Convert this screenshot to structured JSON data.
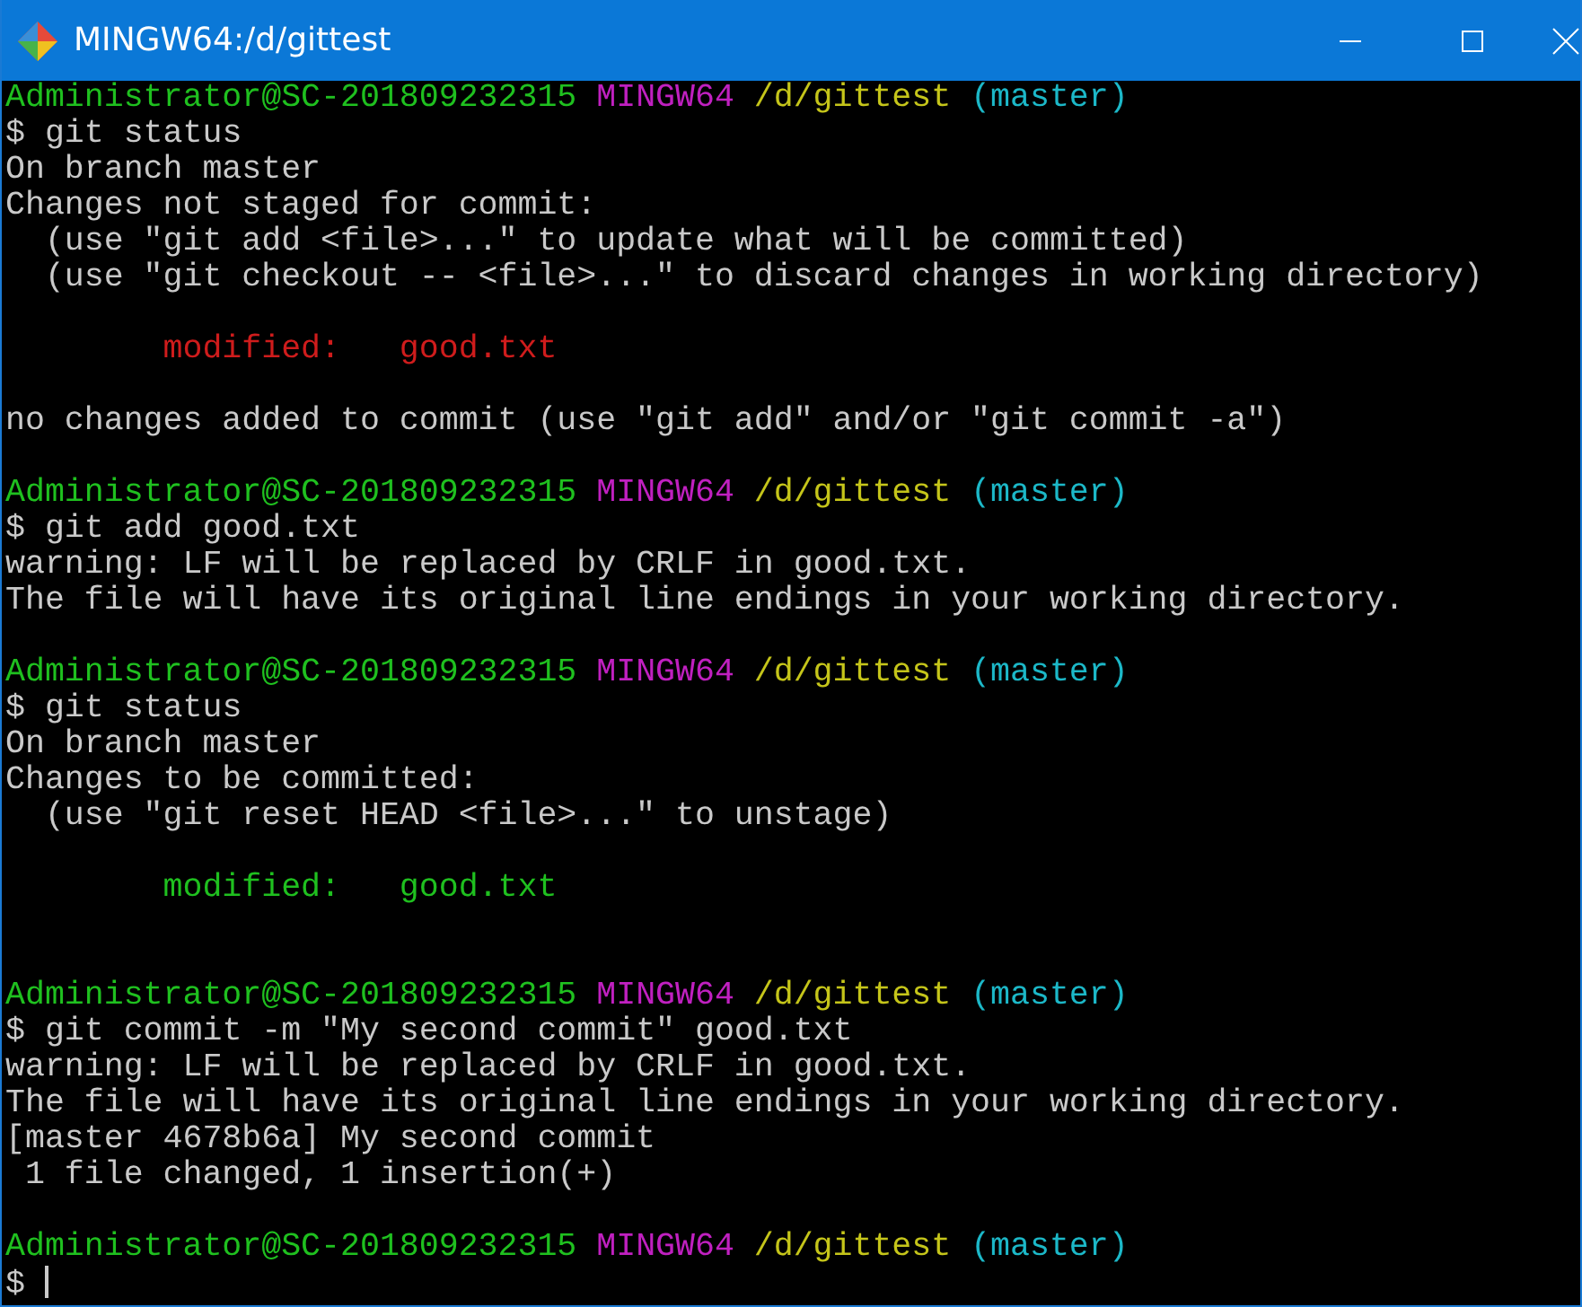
{
  "window": {
    "title": "MINGW64:/d/gittest"
  },
  "terminal_lines": [
    {
      "kind": "prompt",
      "user": "Administrator@SC-201809232315",
      "host": "MINGW64",
      "path": "/d/gittest",
      "branch": "(master)"
    },
    {
      "kind": "command",
      "symbol": "$",
      "text": "git status"
    },
    {
      "kind": "output",
      "text": "On branch master"
    },
    {
      "kind": "output",
      "text": "Changes not staged for commit:"
    },
    {
      "kind": "output",
      "text": "  (use \"git add <file>...\" to update what will be committed)"
    },
    {
      "kind": "output",
      "text": "  (use \"git checkout -- <file>...\" to discard changes in working directory)"
    },
    {
      "kind": "blank"
    },
    {
      "kind": "unstaged",
      "text": "        modified:   good.txt"
    },
    {
      "kind": "blank"
    },
    {
      "kind": "output",
      "text": "no changes added to commit (use \"git add\" and/or \"git commit -a\")"
    },
    {
      "kind": "blank"
    },
    {
      "kind": "prompt",
      "user": "Administrator@SC-201809232315",
      "host": "MINGW64",
      "path": "/d/gittest",
      "branch": "(master)"
    },
    {
      "kind": "command",
      "symbol": "$",
      "text": "git add good.txt"
    },
    {
      "kind": "output",
      "text": "warning: LF will be replaced by CRLF in good.txt."
    },
    {
      "kind": "output",
      "text": "The file will have its original line endings in your working directory."
    },
    {
      "kind": "blank"
    },
    {
      "kind": "prompt",
      "user": "Administrator@SC-201809232315",
      "host": "MINGW64",
      "path": "/d/gittest",
      "branch": "(master)"
    },
    {
      "kind": "command",
      "symbol": "$",
      "text": "git status"
    },
    {
      "kind": "output",
      "text": "On branch master"
    },
    {
      "kind": "output",
      "text": "Changes to be committed:"
    },
    {
      "kind": "output",
      "text": "  (use \"git reset HEAD <file>...\" to unstage)"
    },
    {
      "kind": "blank"
    },
    {
      "kind": "staged",
      "text": "        modified:   good.txt"
    },
    {
      "kind": "blank"
    },
    {
      "kind": "blank"
    },
    {
      "kind": "prompt",
      "user": "Administrator@SC-201809232315",
      "host": "MINGW64",
      "path": "/d/gittest",
      "branch": "(master)"
    },
    {
      "kind": "command",
      "symbol": "$",
      "text": "git commit -m \"My second commit\" good.txt"
    },
    {
      "kind": "output",
      "text": "warning: LF will be replaced by CRLF in good.txt."
    },
    {
      "kind": "output",
      "text": "The file will have its original line endings in your working directory."
    },
    {
      "kind": "output",
      "text": "[master 4678b6a] My second commit"
    },
    {
      "kind": "output",
      "text": " 1 file changed, 1 insertion(+)"
    },
    {
      "kind": "blank"
    },
    {
      "kind": "prompt",
      "user": "Administrator@SC-201809232315",
      "host": "MINGW64",
      "path": "/d/gittest",
      "branch": "(master)"
    },
    {
      "kind": "input",
      "symbol": "$"
    }
  ]
}
